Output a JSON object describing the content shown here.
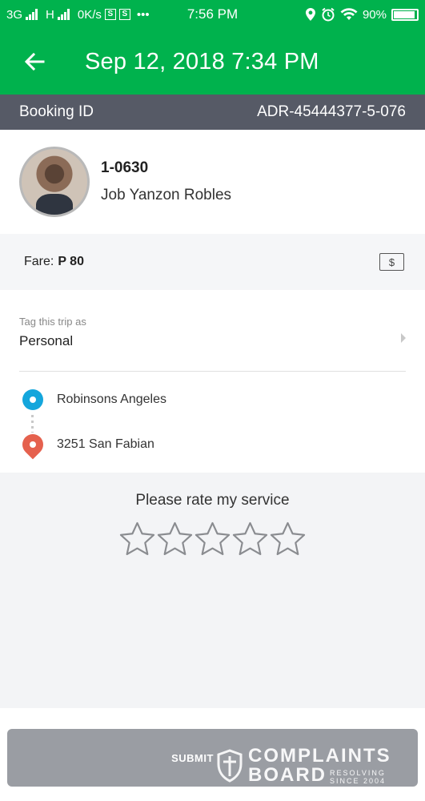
{
  "status_bar": {
    "network_1": "3G",
    "network_2": "H",
    "speed": "0K/s",
    "more": "•••",
    "time": "7:56 PM",
    "battery": "90%"
  },
  "header": {
    "title": "Sep 12, 2018 7:34 PM"
  },
  "booking": {
    "label": "Booking ID",
    "id": "ADR-45444377-5-076"
  },
  "driver": {
    "plate": "1-0630",
    "name": "Job Yanzon Robles"
  },
  "fare": {
    "label": "Fare:",
    "amount": "P 80",
    "payment_icon": "cash-icon"
  },
  "tag": {
    "label": "Tag this trip as",
    "value": "Personal"
  },
  "route": {
    "pickup": "Robinsons Angeles",
    "dropoff": "3251 San Fabian"
  },
  "rating": {
    "title": "Please rate my service",
    "rating": 0,
    "max": 5
  },
  "submit": {
    "label": "SUBMIT"
  },
  "watermark": {
    "line1": "COMPLAINTS",
    "line2": "BOARD",
    "tag1": "RESOLVING",
    "tag2": "SINCE 2004"
  },
  "colors": {
    "brand": "#00b24d",
    "booking_bar": "#565a66",
    "pickup": "#14a6dc",
    "dropoff": "#e5614e",
    "submit_disabled": "#9a9da3"
  }
}
